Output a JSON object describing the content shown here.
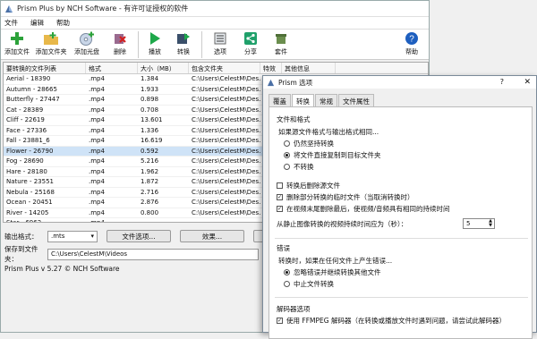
{
  "window": {
    "title": "Prism Plus by NCH Software - 有许可证授权的软件"
  },
  "menu": [
    "文件",
    "编辑",
    "帮助"
  ],
  "toolbar": {
    "add_file": "添加文件",
    "add_folder": "添加文件夹",
    "add_disc": "添加光盘",
    "delete": "删除",
    "play": "播放",
    "convert": "转换",
    "options": "选项",
    "share": "分享",
    "suite": "套件",
    "help": "帮助"
  },
  "grid": {
    "headers": [
      "要转换的文件列表",
      "格式",
      "大小（MB）",
      "包含文件夹",
      "特效",
      "其他信息"
    ],
    "rows": [
      {
        "name": "Aerial - 18390",
        "fmt": ".mp4",
        "size": "1.384",
        "folder": "C:\\Users\\CelestM\\Des..."
      },
      {
        "name": "Autumn - 28665",
        "fmt": ".mp4",
        "size": "1.933",
        "folder": "C:\\Users\\CelestM\\Des..."
      },
      {
        "name": "Butterfly - 27447",
        "fmt": ".mp4",
        "size": "0.898",
        "folder": "C:\\Users\\CelestM\\Des..."
      },
      {
        "name": "Cat - 28389",
        "fmt": ".mp4",
        "size": "0.708",
        "folder": "C:\\Users\\CelestM\\Des..."
      },
      {
        "name": "Cliff - 22619",
        "fmt": ".mp4",
        "size": "13.601",
        "folder": "C:\\Users\\CelestM\\Des..."
      },
      {
        "name": "Face - 27336",
        "fmt": ".mp4",
        "size": "1.336",
        "folder": "C:\\Users\\CelestM\\Des..."
      },
      {
        "name": "Fall - 23881_6",
        "fmt": ".mp4",
        "size": "16.619",
        "folder": "C:\\Users\\CelestM\\Des..."
      },
      {
        "name": "Flower - 26790",
        "fmt": ".mp4",
        "size": "0.592",
        "folder": "C:\\Users\\CelestM\\Des..."
      },
      {
        "name": "Fog - 28690",
        "fmt": ".mp4",
        "size": "5.216",
        "folder": "C:\\Users\\CelestM\\Des..."
      },
      {
        "name": "Hare - 28180",
        "fmt": ".mp4",
        "size": "1.962",
        "folder": "C:\\Users\\CelestM\\Des..."
      },
      {
        "name": "Nature - 23551",
        "fmt": ".mp4",
        "size": "1.872",
        "folder": "C:\\Users\\CelestM\\Des..."
      },
      {
        "name": "Nebula - 25168",
        "fmt": ".mp4",
        "size": "2.716",
        "folder": "C:\\Users\\CelestM\\Des..."
      },
      {
        "name": "Ocean - 20451",
        "fmt": ".mp4",
        "size": "2.876",
        "folder": "C:\\Users\\CelestM\\Des..."
      },
      {
        "name": "River - 14205",
        "fmt": ".mp4",
        "size": "0.800",
        "folder": "C:\\Users\\CelestM\\Des..."
      },
      {
        "name": "Star - 6962",
        "fmt": ".mp4",
        "size": "",
        "folder": ""
      }
    ]
  },
  "bottom": {
    "output_format_label": "输出格式：",
    "output_format_value": ".mts",
    "file_options": "文件选项...",
    "effects": "效果...",
    "preview": "预览",
    "save_to_label": "保存到文件夹：",
    "save_to_value": "C:\\Users\\CelestM\\Videos"
  },
  "status": "Prism Plus v 5.27 © NCH Software",
  "dialog": {
    "title": "Prism 选项",
    "help": "?",
    "tabs": [
      "覆盖",
      "转换",
      "常规",
      "文件属性"
    ],
    "section1": "文件和格式",
    "q1": "如果源文件格式与输出格式相同...",
    "r1": "仍然坚持转换",
    "r2": "将文件直接复制到目标文件夹",
    "r3": "不转换",
    "c1": "转换后删除源文件",
    "c2": "删除部分转换的临时文件（当取消转换时）",
    "c3": "在视频末尾删除最后，使视频/音频具有相同的持续时间",
    "still": "从静止图像转换的视频持续时间应为（秒）：",
    "still_val": "5",
    "section2": "错误",
    "q2": "转换时，如果在任何文件上产生错误...",
    "e1": "忽略错误并继续转换其他文件",
    "e2": "中止文件转换",
    "section3": "解码器选项",
    "d1": "使用 FFMPEG 解码器（在转换或播放文件时遇到问题，请尝试此解码器）"
  },
  "colors": {
    "selected_row": "#cfe3f7",
    "play_green": "#1ea84a",
    "help_blue": "#1e5fbf"
  }
}
